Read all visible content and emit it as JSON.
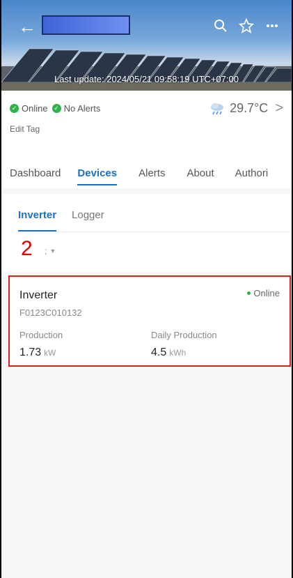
{
  "header": {
    "title": "",
    "last_update": "Last update: 2024/05/21 09:58:19 UTC+07:00",
    "icons": [
      "back-arrow-icon",
      "search-icon",
      "star-icon",
      "more-icon"
    ]
  },
  "status": {
    "online": "Online",
    "alerts": "No Alerts",
    "temperature": "29.7°C",
    "weather_icon": "rain-cloud-icon",
    "edit_tag": "Edit Tag"
  },
  "tabs": [
    "Dashboard",
    "Devices",
    "Alerts",
    "About",
    "Authori"
  ],
  "active_tab": "Devices",
  "subtabs": [
    "Inverter",
    "Logger"
  ],
  "annotation_number": "2",
  "filter_label": ";",
  "device": {
    "name": "Inverter",
    "status": "Online",
    "serial": "F0123C010132",
    "production_label": "Production",
    "production_value": "1.73",
    "production_unit": "kW",
    "daily_label": "Daily Production",
    "daily_value": "4.5",
    "daily_unit": "kWh"
  },
  "colors": {
    "accent": "#1c70c4",
    "online": "#2fb24a",
    "highlight": "#e21b1b"
  }
}
